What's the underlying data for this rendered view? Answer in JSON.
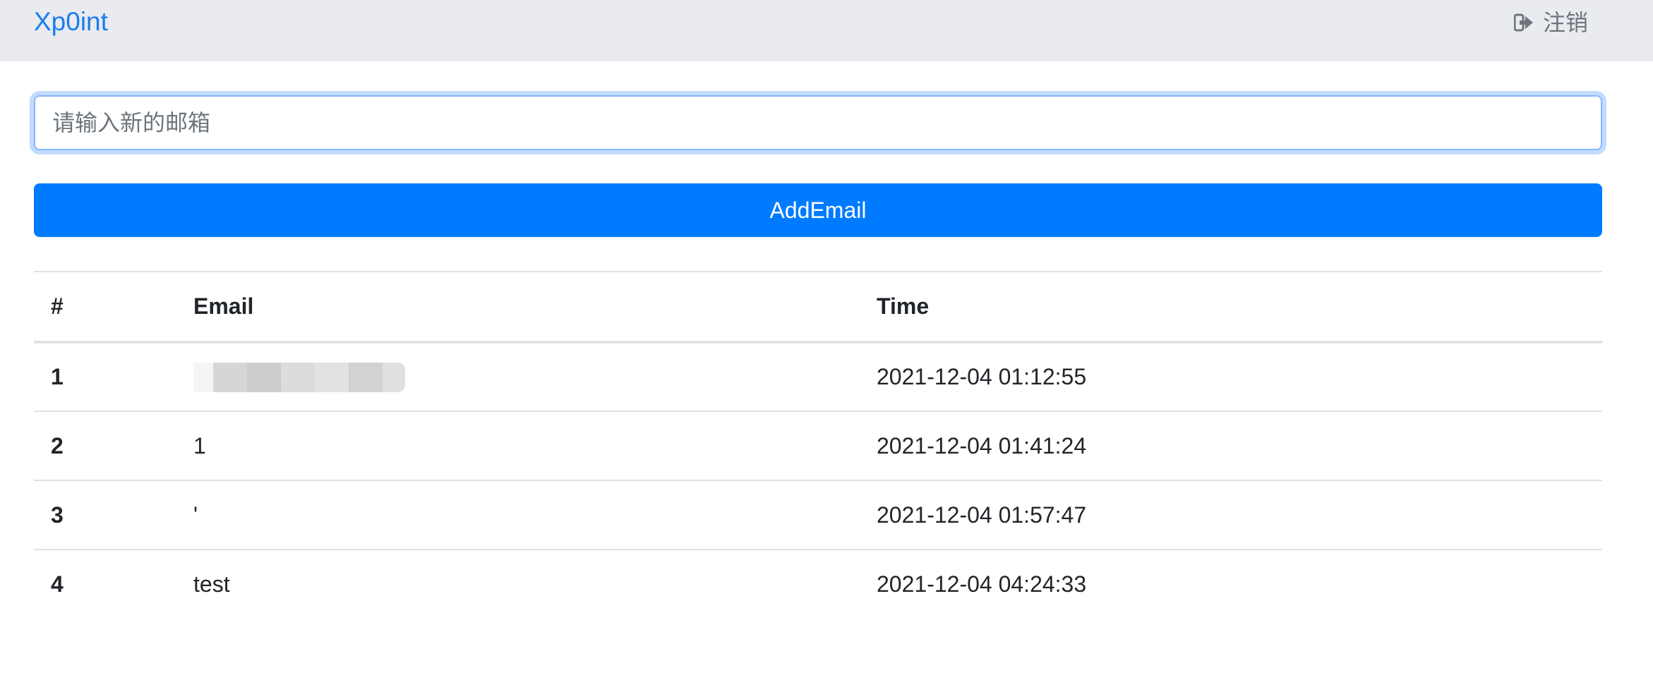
{
  "header": {
    "brand": "Xp0int",
    "logout_label": "注销",
    "logout_icon": "sign-out-icon",
    "colors": {
      "background": "#e9ebef",
      "brand": "#1a7cf0",
      "logout": "#6c757d"
    }
  },
  "form": {
    "email_placeholder": "请输入新的邮箱",
    "email_value": "",
    "add_button_label": "AddEmail",
    "colors": {
      "button": "#007bff",
      "focus_border": "#86b7fe"
    }
  },
  "table": {
    "columns": [
      "#",
      "Email",
      "Time"
    ],
    "rows": [
      {
        "num": "1",
        "email": "",
        "email_redacted": true,
        "time": "2021-12-04 01:12:55"
      },
      {
        "num": "2",
        "email": "1",
        "time": "2021-12-04 01:41:24"
      },
      {
        "num": "3",
        "email": "'",
        "time": "2021-12-04 01:57:47"
      },
      {
        "num": "4",
        "email": "test",
        "time": "2021-12-04 04:24:33"
      }
    ]
  }
}
